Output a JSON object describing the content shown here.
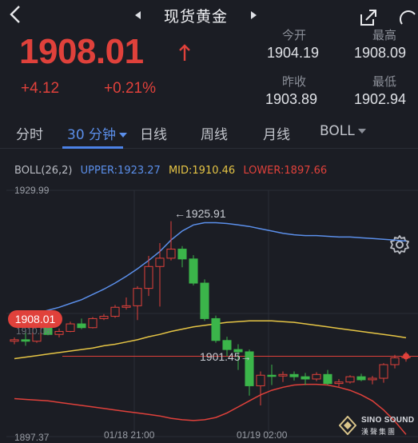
{
  "nav": {
    "title": "现货黄金"
  },
  "quote": {
    "price": "1908.01",
    "change": "+4.12",
    "change_pct": "+0.21%",
    "stats": [
      {
        "label": "今开",
        "value": "1904.19"
      },
      {
        "label": "最高",
        "value": "1908.09"
      },
      {
        "label": "昨收",
        "value": "1903.89"
      },
      {
        "label": "最低",
        "value": "1902.94"
      }
    ]
  },
  "tabs": [
    {
      "label": "分时"
    },
    {
      "label": "30 分钟"
    },
    {
      "label": "日线"
    },
    {
      "label": "周线"
    },
    {
      "label": "月线"
    },
    {
      "label": "BOLL"
    }
  ],
  "indicator": {
    "name": "BOLL(26,2)",
    "upper": "UPPER:1923.27",
    "mid": "MID:1910.46",
    "lower": "LOWER:1897.66"
  },
  "chart_data": {
    "type": "candlestick",
    "y_top_label": "1929.99",
    "y_bottom_label": "1897.37",
    "y_mid_label": "1910.06",
    "ylim": [
      1897.37,
      1929.99
    ],
    "current_price_label": "1908.01",
    "current_price": 1908.01,
    "high_annotation": "←1925.91",
    "low_annotation": "1901.45→",
    "x_labels": [
      "01/18 21:00",
      "01/19 02:00"
    ],
    "candles": [
      [
        1910.0,
        1910.5,
        1909.6,
        1910.2
      ],
      [
        1910.2,
        1911.4,
        1909.4,
        1910.0
      ],
      [
        1910.0,
        1912.1,
        1909.8,
        1911.9
      ],
      [
        1911.9,
        1913.0,
        1910.8,
        1910.9
      ],
      [
        1910.9,
        1911.7,
        1910.5,
        1911.3
      ],
      [
        1911.3,
        1912.6,
        1911.2,
        1912.3
      ],
      [
        1912.3,
        1913.0,
        1911.6,
        1911.8
      ],
      [
        1911.8,
        1913.2,
        1911.7,
        1913.0
      ],
      [
        1913.0,
        1913.6,
        1912.8,
        1913.3
      ],
      [
        1913.3,
        1914.8,
        1913.1,
        1914.5
      ],
      [
        1914.5,
        1915.8,
        1914.2,
        1914.7
      ],
      [
        1914.7,
        1917.3,
        1912.8,
        1917.0
      ],
      [
        1917.0,
        1921.3,
        1916.0,
        1919.9
      ],
      [
        1919.9,
        1923.0,
        1914.6,
        1921.0
      ],
      [
        1921.0,
        1925.9,
        1920.7,
        1922.2
      ],
      [
        1922.2,
        1922.6,
        1919.8,
        1920.9
      ],
      [
        1920.9,
        1921.4,
        1917.4,
        1917.7
      ],
      [
        1917.7,
        1918.2,
        1912.7,
        1913.0
      ],
      [
        1913.0,
        1913.4,
        1909.8,
        1910.1
      ],
      [
        1910.1,
        1910.6,
        1908.0,
        1908.9
      ],
      [
        1908.9,
        1909.6,
        1906.2,
        1908.6
      ],
      [
        1908.6,
        1908.9,
        1902.8,
        1904.1
      ],
      [
        1904.1,
        1906.0,
        1901.5,
        1905.5
      ],
      [
        1905.5,
        1906.9,
        1904.2,
        1905.4
      ],
      [
        1905.4,
        1906.0,
        1904.6,
        1905.6
      ],
      [
        1905.6,
        1906.0,
        1904.8,
        1905.3
      ],
      [
        1905.3,
        1905.8,
        1904.2,
        1905.0
      ],
      [
        1905.0,
        1905.9,
        1904.7,
        1905.6
      ],
      [
        1905.6,
        1906.2,
        1904.2,
        1904.4
      ],
      [
        1904.4,
        1905.0,
        1904.0,
        1904.6
      ],
      [
        1904.6,
        1905.5,
        1904.4,
        1905.3
      ],
      [
        1905.3,
        1905.7,
        1904.7,
        1904.9
      ],
      [
        1904.9,
        1905.4,
        1904.3,
        1905.1
      ],
      [
        1905.1,
        1907.1,
        1904.5,
        1906.9
      ],
      [
        1906.9,
        1908.2,
        1906.4,
        1907.8
      ],
      [
        1907.8,
        1908.6,
        1907.3,
        1908.01
      ]
    ],
    "upper_band": [
      1913.0,
      1913.3,
      1913.7,
      1914.1,
      1914.5,
      1915.0,
      1915.5,
      1916.2,
      1916.9,
      1917.7,
      1918.6,
      1919.6,
      1920.7,
      1921.9,
      1923.4,
      1924.6,
      1925.4,
      1925.7,
      1925.7,
      1925.6,
      1925.4,
      1925.2,
      1924.9,
      1924.6,
      1924.3,
      1924.1,
      1924.0,
      1924.0,
      1923.9,
      1923.8,
      1923.8,
      1923.7,
      1923.6,
      1923.5,
      1923.4,
      1923.27
    ],
    "mid_band": [
      1907.7,
      1907.9,
      1908.1,
      1908.3,
      1908.5,
      1908.7,
      1908.9,
      1909.1,
      1909.4,
      1909.6,
      1909.9,
      1910.2,
      1910.6,
      1910.9,
      1911.3,
      1911.6,
      1911.9,
      1912.1,
      1912.3,
      1912.5,
      1912.6,
      1912.7,
      1912.7,
      1912.7,
      1912.6,
      1912.5,
      1912.3,
      1912.1,
      1911.9,
      1911.7,
      1911.5,
      1911.3,
      1911.1,
      1910.9,
      1910.7,
      1910.46
    ],
    "lower_band": [
      1902.4,
      1902.3,
      1902.2,
      1902.1,
      1901.9,
      1901.7,
      1901.5,
      1901.3,
      1901.1,
      1900.9,
      1900.7,
      1900.5,
      1900.3,
      1900.1,
      1899.8,
      1899.6,
      1899.5,
      1899.6,
      1899.9,
      1900.5,
      1901.3,
      1902.1,
      1902.9,
      1903.5,
      1903.9,
      1904.2,
      1904.3,
      1904.3,
      1904.2,
      1903.9,
      1903.5,
      1902.9,
      1902.1,
      1900.9,
      1899.4,
      1897.66
    ],
    "colors": {
      "up": "#e0413b",
      "down": "#3bb54a",
      "upper": "#5b8fea",
      "mid": "#e6c545",
      "lower": "#e0413b"
    }
  },
  "footer": {
    "logo_text": "SINO SOUND",
    "logo_sub": "漢聲集團"
  }
}
